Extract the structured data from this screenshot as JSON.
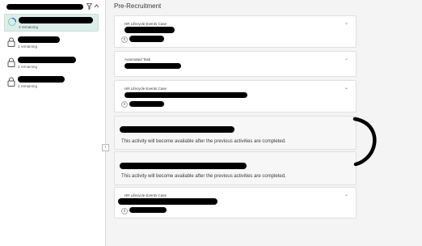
{
  "left_panel": {
    "items": [
      {
        "status": "2 remaining",
        "icon": "progress-ring-icon"
      },
      {
        "status": "1 remaining",
        "icon": "lock-icon"
      },
      {
        "status": "1 remaining",
        "icon": "lock-icon"
      },
      {
        "status": "1 remaining",
        "icon": "lock-icon"
      }
    ]
  },
  "main": {
    "title": "Pre-Recruitment",
    "cards": [
      {
        "type": "HR Lifecycle Events Case",
        "badge": "0"
      },
      {
        "type": "Automated Task"
      },
      {
        "type": "HR Lifecycle Events Case",
        "badge": "0"
      },
      {
        "message": "This activity will become available after the previous activities are completed."
      },
      {
        "message": "This activity will become available after the previous activities are completed."
      },
      {
        "type": "HR Lifecycle Events Case",
        "badge": "0"
      }
    ]
  },
  "colors": {
    "active_item_bg": "#dceee9",
    "page_bg": "#f4f4f4",
    "card_bg": "#ffffff"
  }
}
